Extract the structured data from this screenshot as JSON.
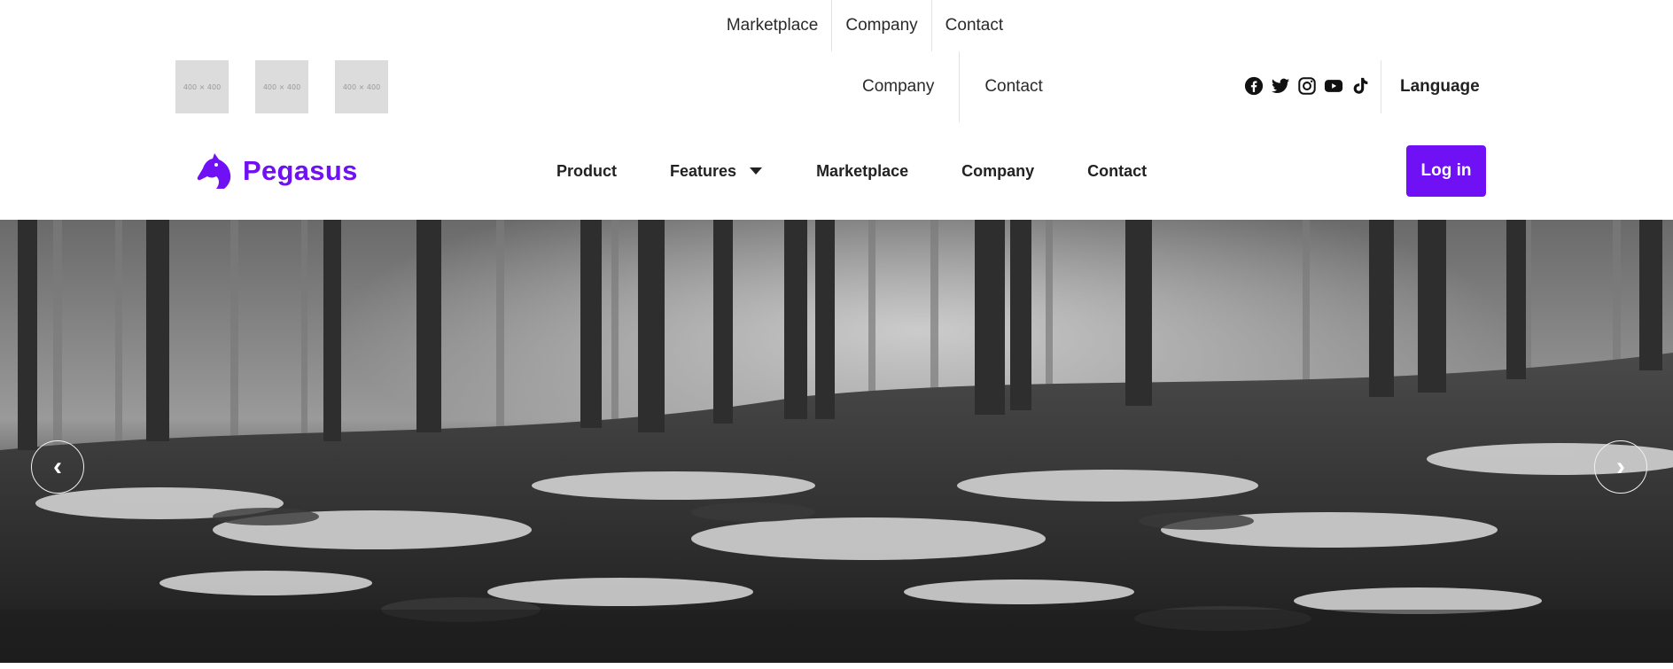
{
  "top_nav": {
    "items": [
      "Marketplace",
      "Company",
      "Contact"
    ]
  },
  "row2": {
    "thumbnails": [
      "400 × 400",
      "400 × 400",
      "400 × 400"
    ],
    "links": [
      "Company",
      "Contact"
    ],
    "socials": [
      "facebook-icon",
      "twitter-icon",
      "instagram-icon",
      "youtube-icon",
      "tiktok-icon"
    ],
    "language_label": "Language"
  },
  "main_nav": {
    "brand": "Pegasus",
    "items": [
      "Product",
      "Features",
      "Marketplace",
      "Company",
      "Contact"
    ],
    "login_label": "Log in"
  },
  "hero": {
    "prev_glyph": "‹",
    "next_glyph": "›"
  },
  "colors": {
    "brand": "#7010f5",
    "text": "#222222",
    "separator": "#e3e3e3"
  }
}
